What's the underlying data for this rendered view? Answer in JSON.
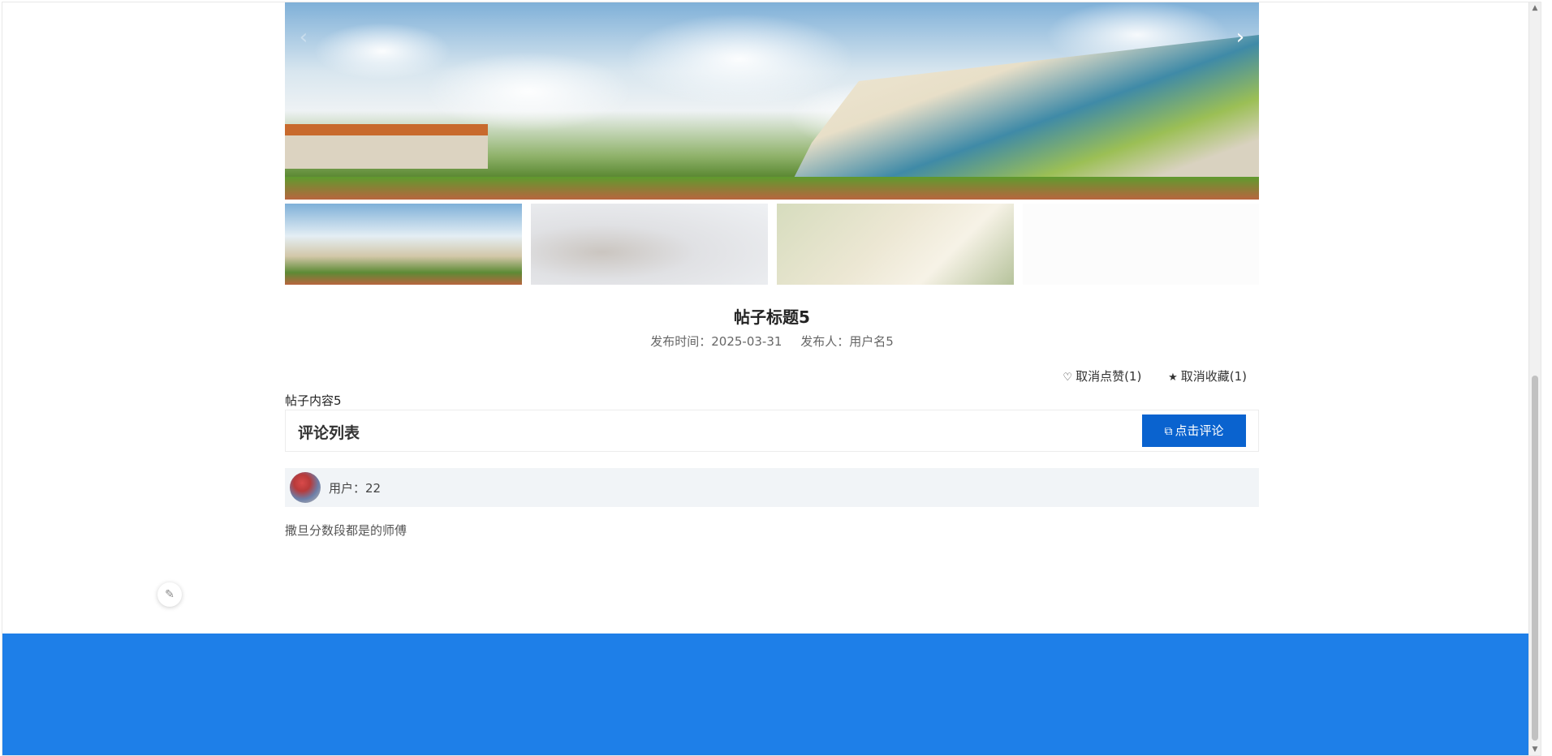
{
  "carousel": {
    "prev_icon": "‹",
    "next_icon": "›",
    "thumbnails": [
      "stadium",
      "fantasy-clouds",
      "book-and-cup",
      "blank"
    ]
  },
  "post": {
    "title": "帖子标题5",
    "publish_time": "发布时间：2025-03-31",
    "author": "发布人：用户名5",
    "unlike_label": "取消点赞(1)",
    "unfavorite_label": "取消收藏(1)",
    "content": "帖子内容5"
  },
  "comments": {
    "title": "评论列表",
    "add_button": "点击评论",
    "items": [
      {
        "user": "用户：22",
        "text": "撒旦分数段都是的师傅"
      }
    ]
  },
  "icons": {
    "heart": "♡",
    "star": "★",
    "edit": "⧉",
    "float": "✎"
  },
  "colors": {
    "footer": "#1e7fe8",
    "button": "#0a63cf"
  }
}
